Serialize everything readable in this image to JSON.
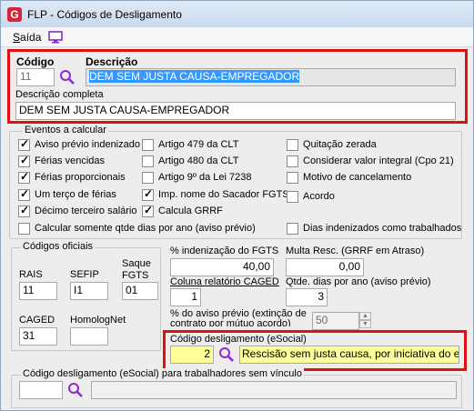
{
  "window": {
    "title": "FLP - Códigos de Desligamento",
    "icon_letter": "G",
    "icon": "app-logo-icon"
  },
  "menu": {
    "items": [
      {
        "label_u": "S",
        "label_rest": "aída"
      }
    ],
    "icon": "monitor-icon"
  },
  "header": {
    "codigo_label": "Código",
    "codigo_value": "11",
    "descricao_label": "Descrição",
    "descricao_value": "DEM SEM JUSTA CAUSA-EMPREGADOR",
    "descricao_completa_label": "Descrição completa",
    "descricao_completa_value": "DEM SEM JUSTA CAUSA-EMPREGADOR"
  },
  "eventos": {
    "title": "Eventos a calcular",
    "checkboxes": [
      {
        "label": "Aviso prévio indenizado",
        "checked": true
      },
      {
        "label": "Férias vencidas",
        "checked": true
      },
      {
        "label": "Férias proporcionais",
        "checked": true
      },
      {
        "label": "Um terço de férias",
        "checked": true
      },
      {
        "label": "Décimo terceiro salário",
        "checked": true
      },
      {
        "label": "Artigo 479 da CLT",
        "checked": false
      },
      {
        "label": "Artigo 480 da CLT",
        "checked": false
      },
      {
        "label": "Artigo 9º da Lei 7238",
        "checked": false
      },
      {
        "label": "Imp. nome do Sacador FGTS",
        "checked": true
      },
      {
        "label": "Calcula GRRF",
        "checked": true
      },
      {
        "label": "Quitação zerada",
        "checked": false
      },
      {
        "label": "Considerar valor integral (Cpo 21)",
        "checked": false
      },
      {
        "label": "Motivo de cancelamento",
        "checked": false
      },
      {
        "label": "Acordo",
        "checked": false
      },
      {
        "label": "Calcular somente qtde dias por ano (aviso prévio)",
        "checked": false
      },
      {
        "label": "Dias indenizados como trabalhados",
        "checked": false
      }
    ]
  },
  "codigos_oficiais": {
    "title": "Códigos oficiais",
    "rais_label": "RAIS",
    "rais_value": "11",
    "sefip_label": "SEFIP",
    "sefip_value": "I1",
    "saque_label_1": "Saque",
    "saque_label_2": "FGTS",
    "saque_value": "01",
    "caged_label": "CAGED",
    "caged_value": "31",
    "homolognet_label": "HomologNet",
    "homolognet_value": ""
  },
  "right_fields": {
    "indenizacao_label": "% indenização do FGTS",
    "indenizacao_value": "40,00",
    "multa_label": "Multa Resc. (GRRF em Atraso)",
    "multa_value": "0,00",
    "coluna_caged_label": "Coluna relatório CAGED",
    "coluna_caged_value": "1",
    "qtde_dias_label": "Qtde. dias por ano (aviso prévio)",
    "qtde_dias_value": "3",
    "aviso_extincao_label_1": "% do aviso prévio (extinção de",
    "aviso_extincao_label_2": "contrato por mútuo acordo)",
    "aviso_extincao_value": "50"
  },
  "esocial": {
    "label": "Código desligamento (eSocial)",
    "code_value": "2",
    "description_value": "Rescisão sem justa causa, por iniciativa do empre"
  },
  "esocial_sem_vinculo": {
    "label": "Código desligamento (eSocial) para trabalhadores sem vínculo",
    "code_value": "",
    "description_value": ""
  },
  "colors": {
    "highlight_border": "#e01010",
    "selection": "#3399ff",
    "yellow_field": "#ffff99"
  }
}
